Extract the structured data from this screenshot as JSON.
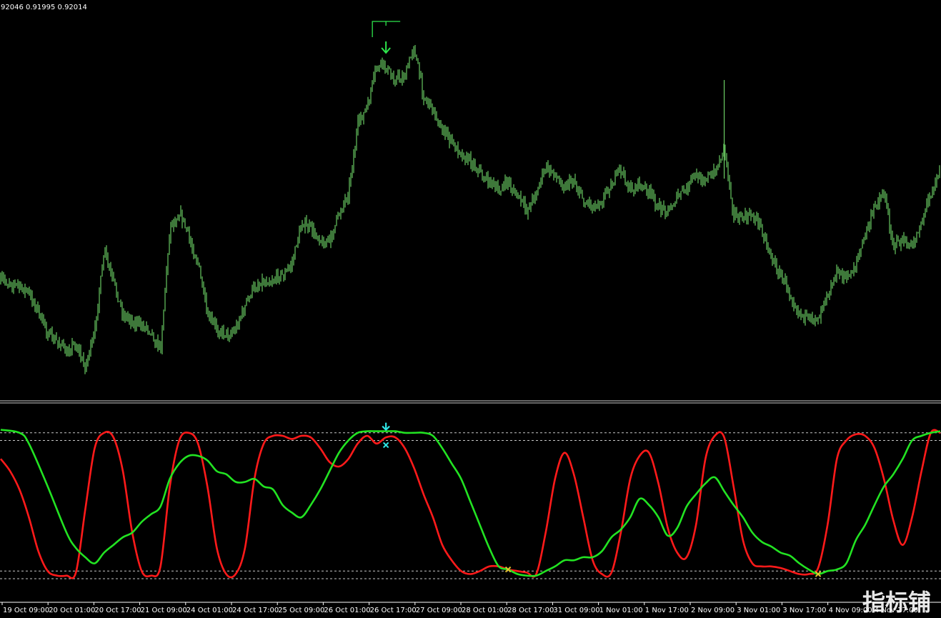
{
  "window": {
    "price_header": "92046 0.91995 0.92014",
    "watermark_text": "指标铺"
  },
  "colors": {
    "background": "#000000",
    "candle": "#7CEF73",
    "line_fast": "#FF1A1A",
    "line_slow": "#22E322",
    "signal_down_price": "#2EE64C",
    "signal_cyan": "#2EE6E6",
    "signal_cross": "#E6C22E",
    "levels": "#C8C8C8",
    "axis_text": "#FFFFFF",
    "watermark": "#FFFFFF"
  },
  "time_axis": {
    "labels": [
      "19 Oct 09:00",
      "20 Oct 01:00",
      "20 Oct 17:00",
      "21 Oct 09:00",
      "24 Oct 01:00",
      "24 Oct 17:00",
      "25 Oct 09:00",
      "26 Oct 01:00",
      "26 Oct 17:00",
      "27 Oct 09:00",
      "28 Oct 01:00",
      "28 Oct 17:00",
      "31 Oct 09:00",
      "1 Nov 01:00",
      "1 Nov 17:00",
      "2 Nov 09:00",
      "3 Nov 01:00",
      "3 Nov 17:00",
      "4 Nov 09:00",
      "4 Nov 17:00"
    ]
  },
  "chart_data": [
    {
      "type": "line",
      "panel": "price",
      "render": "bars",
      "x_range": [
        0,
        100
      ],
      "close_path": [
        [
          0,
          390
        ],
        [
          3,
          410
        ],
        [
          5,
          465
        ],
        [
          7,
          490
        ],
        [
          8,
          480
        ],
        [
          9,
          515
        ],
        [
          10,
          465
        ],
        [
          11,
          352
        ],
        [
          13,
          440
        ],
        [
          14,
          450
        ],
        [
          15,
          455
        ],
        [
          16,
          465
        ],
        [
          17,
          490
        ],
        [
          18,
          320
        ],
        [
          19,
          295
        ],
        [
          21,
          368
        ],
        [
          22,
          440
        ],
        [
          23,
          460
        ],
        [
          24,
          470
        ],
        [
          25,
          458
        ],
        [
          26,
          430
        ],
        [
          27,
          400
        ],
        [
          28,
          392
        ],
        [
          29,
          390
        ],
        [
          30,
          385
        ],
        [
          31,
          370
        ],
        [
          32,
          310
        ],
        [
          33,
          320
        ],
        [
          34,
          335
        ],
        [
          35,
          340
        ],
        [
          36,
          300
        ],
        [
          37,
          270
        ],
        [
          38,
          175
        ],
        [
          39,
          150
        ],
        [
          40,
          95
        ],
        [
          41,
          95
        ],
        [
          42,
          110
        ],
        [
          43,
          105
        ],
        [
          44,
          65
        ],
        [
          45,
          135
        ],
        [
          46,
          155
        ],
        [
          47,
          180
        ],
        [
          48,
          200
        ],
        [
          49,
          215
        ],
        [
          50,
          225
        ],
        [
          51,
          240
        ],
        [
          52,
          255
        ],
        [
          53,
          265
        ],
        [
          54,
          255
        ],
        [
          55,
          275
        ],
        [
          56,
          295
        ],
        [
          57,
          270
        ],
        [
          58,
          235
        ],
        [
          59,
          245
        ],
        [
          60,
          260
        ],
        [
          61,
          250
        ],
        [
          62,
          280
        ],
        [
          63,
          290
        ],
        [
          64,
          280
        ],
        [
          65,
          255
        ],
        [
          66,
          240
        ],
        [
          67,
          265
        ],
        [
          68,
          260
        ],
        [
          69,
          270
        ],
        [
          70,
          290
        ],
        [
          71,
          295
        ],
        [
          72,
          275
        ],
        [
          73,
          265
        ],
        [
          74,
          245
        ],
        [
          75,
          250
        ],
        [
          76,
          240
        ],
        [
          77,
          210
        ],
        [
          78,
          300
        ],
        [
          79,
          305
        ],
        [
          80,
          300
        ],
        [
          81,
          320
        ],
        [
          82,
          360
        ],
        [
          83,
          385
        ],
        [
          84,
          410
        ],
        [
          85,
          440
        ],
        [
          86,
          450
        ],
        [
          87,
          445
        ],
        [
          88,
          410
        ],
        [
          89,
          380
        ],
        [
          90,
          390
        ],
        [
          91,
          370
        ],
        [
          92,
          330
        ],
        [
          93,
          290
        ],
        [
          94,
          265
        ],
        [
          95,
          345
        ],
        [
          96,
          335
        ],
        [
          97,
          345
        ],
        [
          98,
          310
        ],
        [
          99,
          270
        ],
        [
          100,
          235
        ]
      ],
      "annotations": [
        {
          "kind": "sell-arrow",
          "x": 41
        },
        {
          "kind": "level-marker",
          "x": 41
        }
      ]
    },
    {
      "type": "line",
      "panel": "oscillator",
      "x_range": [
        0,
        100
      ],
      "ylim": [
        0,
        100
      ],
      "levels": [
        95,
        90,
        5,
        0
      ],
      "series": [
        {
          "role": "fast",
          "color": "#FF1A1A",
          "values": [
            [
              0,
              78
            ],
            [
              1,
              70
            ],
            [
              2,
              58
            ],
            [
              3,
              40
            ],
            [
              4,
              18
            ],
            [
              5,
              5
            ],
            [
              6,
              2
            ],
            [
              7,
              2
            ],
            [
              8,
              4
            ],
            [
              9,
              45
            ],
            [
              10,
              85
            ],
            [
              11,
              95
            ],
            [
              12,
              92
            ],
            [
              13,
              70
            ],
            [
              14,
              30
            ],
            [
              15,
              5
            ],
            [
              16,
              2
            ],
            [
              17,
              8
            ],
            [
              18,
              60
            ],
            [
              19,
              90
            ],
            [
              20,
              95
            ],
            [
              21,
              88
            ],
            [
              22,
              60
            ],
            [
              23,
              20
            ],
            [
              24,
              3
            ],
            [
              25,
              3
            ],
            [
              26,
              20
            ],
            [
              27,
              65
            ],
            [
              28,
              88
            ],
            [
              29,
              93
            ],
            [
              30,
              93
            ],
            [
              31,
              91
            ],
            [
              32,
              93
            ],
            [
              33,
              92
            ],
            [
              34,
              85
            ],
            [
              35,
              76
            ],
            [
              36,
              73
            ],
            [
              37,
              78
            ],
            [
              38,
              88
            ],
            [
              39,
              93
            ],
            [
              40,
              88
            ],
            [
              41,
              92
            ],
            [
              42,
              92
            ],
            [
              43,
              85
            ],
            [
              44,
              72
            ],
            [
              45,
              55
            ],
            [
              46,
              40
            ],
            [
              47,
              22
            ],
            [
              48,
              12
            ],
            [
              49,
              5
            ],
            [
              50,
              3
            ],
            [
              51,
              5
            ],
            [
              52,
              8
            ],
            [
              53,
              8
            ],
            [
              54,
              6
            ],
            [
              55,
              5
            ],
            [
              56,
              4
            ],
            [
              57,
              3
            ],
            [
              58,
              30
            ],
            [
              59,
              65
            ],
            [
              60,
              82
            ],
            [
              61,
              68
            ],
            [
              62,
              40
            ],
            [
              63,
              12
            ],
            [
              64,
              3
            ],
            [
              65,
              4
            ],
            [
              66,
              30
            ],
            [
              67,
              65
            ],
            [
              68,
              80
            ],
            [
              69,
              82
            ],
            [
              70,
              62
            ],
            [
              71,
              33
            ],
            [
              72,
              17
            ],
            [
              73,
              14
            ],
            [
              74,
              35
            ],
            [
              75,
              78
            ],
            [
              76,
              93
            ],
            [
              77,
              92
            ],
            [
              78,
              60
            ],
            [
              79,
              25
            ],
            [
              80,
              10
            ],
            [
              81,
              8
            ],
            [
              82,
              8
            ],
            [
              83,
              7
            ],
            [
              84,
              5
            ],
            [
              85,
              3
            ],
            [
              86,
              3
            ],
            [
              87,
              7
            ],
            [
              88,
              35
            ],
            [
              89,
              78
            ],
            [
              90,
              90
            ],
            [
              91,
              94
            ],
            [
              92,
              93
            ],
            [
              93,
              85
            ],
            [
              94,
              65
            ],
            [
              95,
              38
            ],
            [
              96,
              22
            ],
            [
              97,
              40
            ],
            [
              98,
              70
            ],
            [
              99,
              95
            ],
            [
              100,
              95
            ]
          ]
        },
        {
          "role": "slow",
          "color": "#22E322",
          "values": [
            [
              0,
              97
            ],
            [
              2,
              95
            ],
            [
              3,
              88
            ],
            [
              5,
              60
            ],
            [
              7,
              30
            ],
            [
              8,
              20
            ],
            [
              9,
              14
            ],
            [
              10,
              10
            ],
            [
              11,
              17
            ],
            [
              12,
              22
            ],
            [
              13,
              27
            ],
            [
              14,
              30
            ],
            [
              15,
              37
            ],
            [
              16,
              42
            ],
            [
              17,
              47
            ],
            [
              18,
              65
            ],
            [
              19,
              75
            ],
            [
              20,
              80
            ],
            [
              21,
              80
            ],
            [
              22,
              77
            ],
            [
              23,
              70
            ],
            [
              24,
              68
            ],
            [
              25,
              63
            ],
            [
              26,
              63
            ],
            [
              27,
              65
            ],
            [
              28,
              60
            ],
            [
              29,
              58
            ],
            [
              30,
              48
            ],
            [
              31,
              43
            ],
            [
              32,
              40
            ],
            [
              33,
              48
            ],
            [
              34,
              58
            ],
            [
              35,
              70
            ],
            [
              36,
              82
            ],
            [
              37,
              90
            ],
            [
              38,
              95
            ],
            [
              39,
              96
            ],
            [
              40,
              96
            ],
            [
              41,
              96
            ],
            [
              42,
              96
            ],
            [
              43,
              95
            ],
            [
              44,
              95
            ],
            [
              45,
              95
            ],
            [
              46,
              93
            ],
            [
              47,
              85
            ],
            [
              48,
              75
            ],
            [
              49,
              65
            ],
            [
              50,
              50
            ],
            [
              51,
              35
            ],
            [
              52,
              20
            ],
            [
              53,
              8
            ],
            [
              54,
              6
            ],
            [
              55,
              3
            ],
            [
              56,
              2
            ],
            [
              57,
              2
            ],
            [
              58,
              5
            ],
            [
              59,
              8
            ],
            [
              60,
              12
            ],
            [
              61,
              12
            ],
            [
              62,
              14
            ],
            [
              63,
              14
            ],
            [
              64,
              18
            ],
            [
              65,
              27
            ],
            [
              66,
              32
            ],
            [
              67,
              40
            ],
            [
              68,
              52
            ],
            [
              69,
              48
            ],
            [
              70,
              40
            ],
            [
              71,
              28
            ],
            [
              72,
              33
            ],
            [
              73,
              47
            ],
            [
              74,
              55
            ],
            [
              75,
              62
            ],
            [
              76,
              66
            ],
            [
              77,
              57
            ],
            [
              78,
              48
            ],
            [
              79,
              40
            ],
            [
              80,
              30
            ],
            [
              81,
              24
            ],
            [
              82,
              21
            ],
            [
              83,
              17
            ],
            [
              84,
              15
            ],
            [
              85,
              10
            ],
            [
              86,
              6
            ],
            [
              87,
              3
            ],
            [
              88,
              5
            ],
            [
              89,
              6
            ],
            [
              90,
              10
            ],
            [
              91,
              25
            ],
            [
              92,
              35
            ],
            [
              93,
              48
            ],
            [
              94,
              60
            ],
            [
              95,
              68
            ],
            [
              96,
              78
            ],
            [
              97,
              90
            ],
            [
              98,
              93
            ],
            [
              99,
              95
            ],
            [
              100,
              96
            ]
          ]
        }
      ],
      "annotations": [
        {
          "kind": "cyan-down-arrow",
          "x": 41,
          "y": 96
        },
        {
          "kind": "cyan-cross",
          "x": 41,
          "y": 87
        },
        {
          "kind": "yellow-cross",
          "x": 54,
          "y": 6
        },
        {
          "kind": "yellow-cross",
          "x": 87,
          "y": 3
        }
      ]
    }
  ]
}
